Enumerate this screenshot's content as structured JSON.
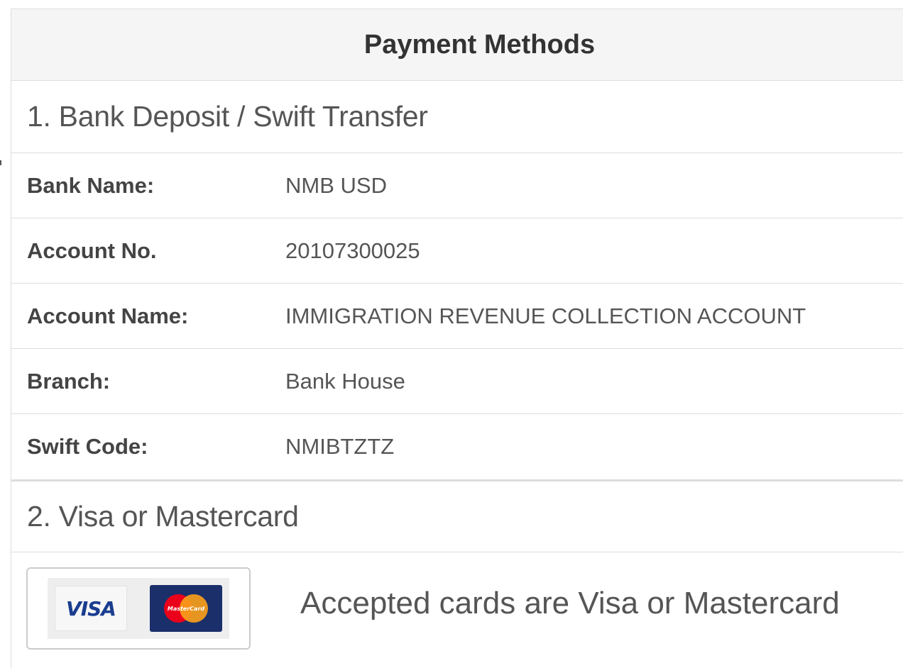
{
  "panel": {
    "title": "Payment Methods"
  },
  "bank_section": {
    "heading": "1. Bank Deposit / Swift Transfer",
    "rows": [
      {
        "label": "Bank Name:",
        "value": "NMB USD"
      },
      {
        "label": "Account No.",
        "value": "20107300025"
      },
      {
        "label": "Account Name:",
        "value": "IMMIGRATION REVENUE COLLECTION ACCOUNT"
      },
      {
        "label": "Branch:",
        "value": "Bank House"
      },
      {
        "label": "Swift Code:",
        "value": "NMIBTZTZ"
      }
    ]
  },
  "card_section": {
    "heading": "2. Visa or Mastercard",
    "visa_text": "VISA",
    "mastercard_text": "MasterCard",
    "caption": "Accepted cards are Visa or Mastercard"
  },
  "colors": {
    "header_bg": "#f5f5f5",
    "border": "#dddddd",
    "visa_blue": "#1a3d8f",
    "mastercard_navy": "#1b2f6b",
    "mastercard_red": "#eb001b",
    "mastercard_orange": "#f79e1b"
  },
  "icons": [
    "visa-logo",
    "mastercard-logo"
  ]
}
